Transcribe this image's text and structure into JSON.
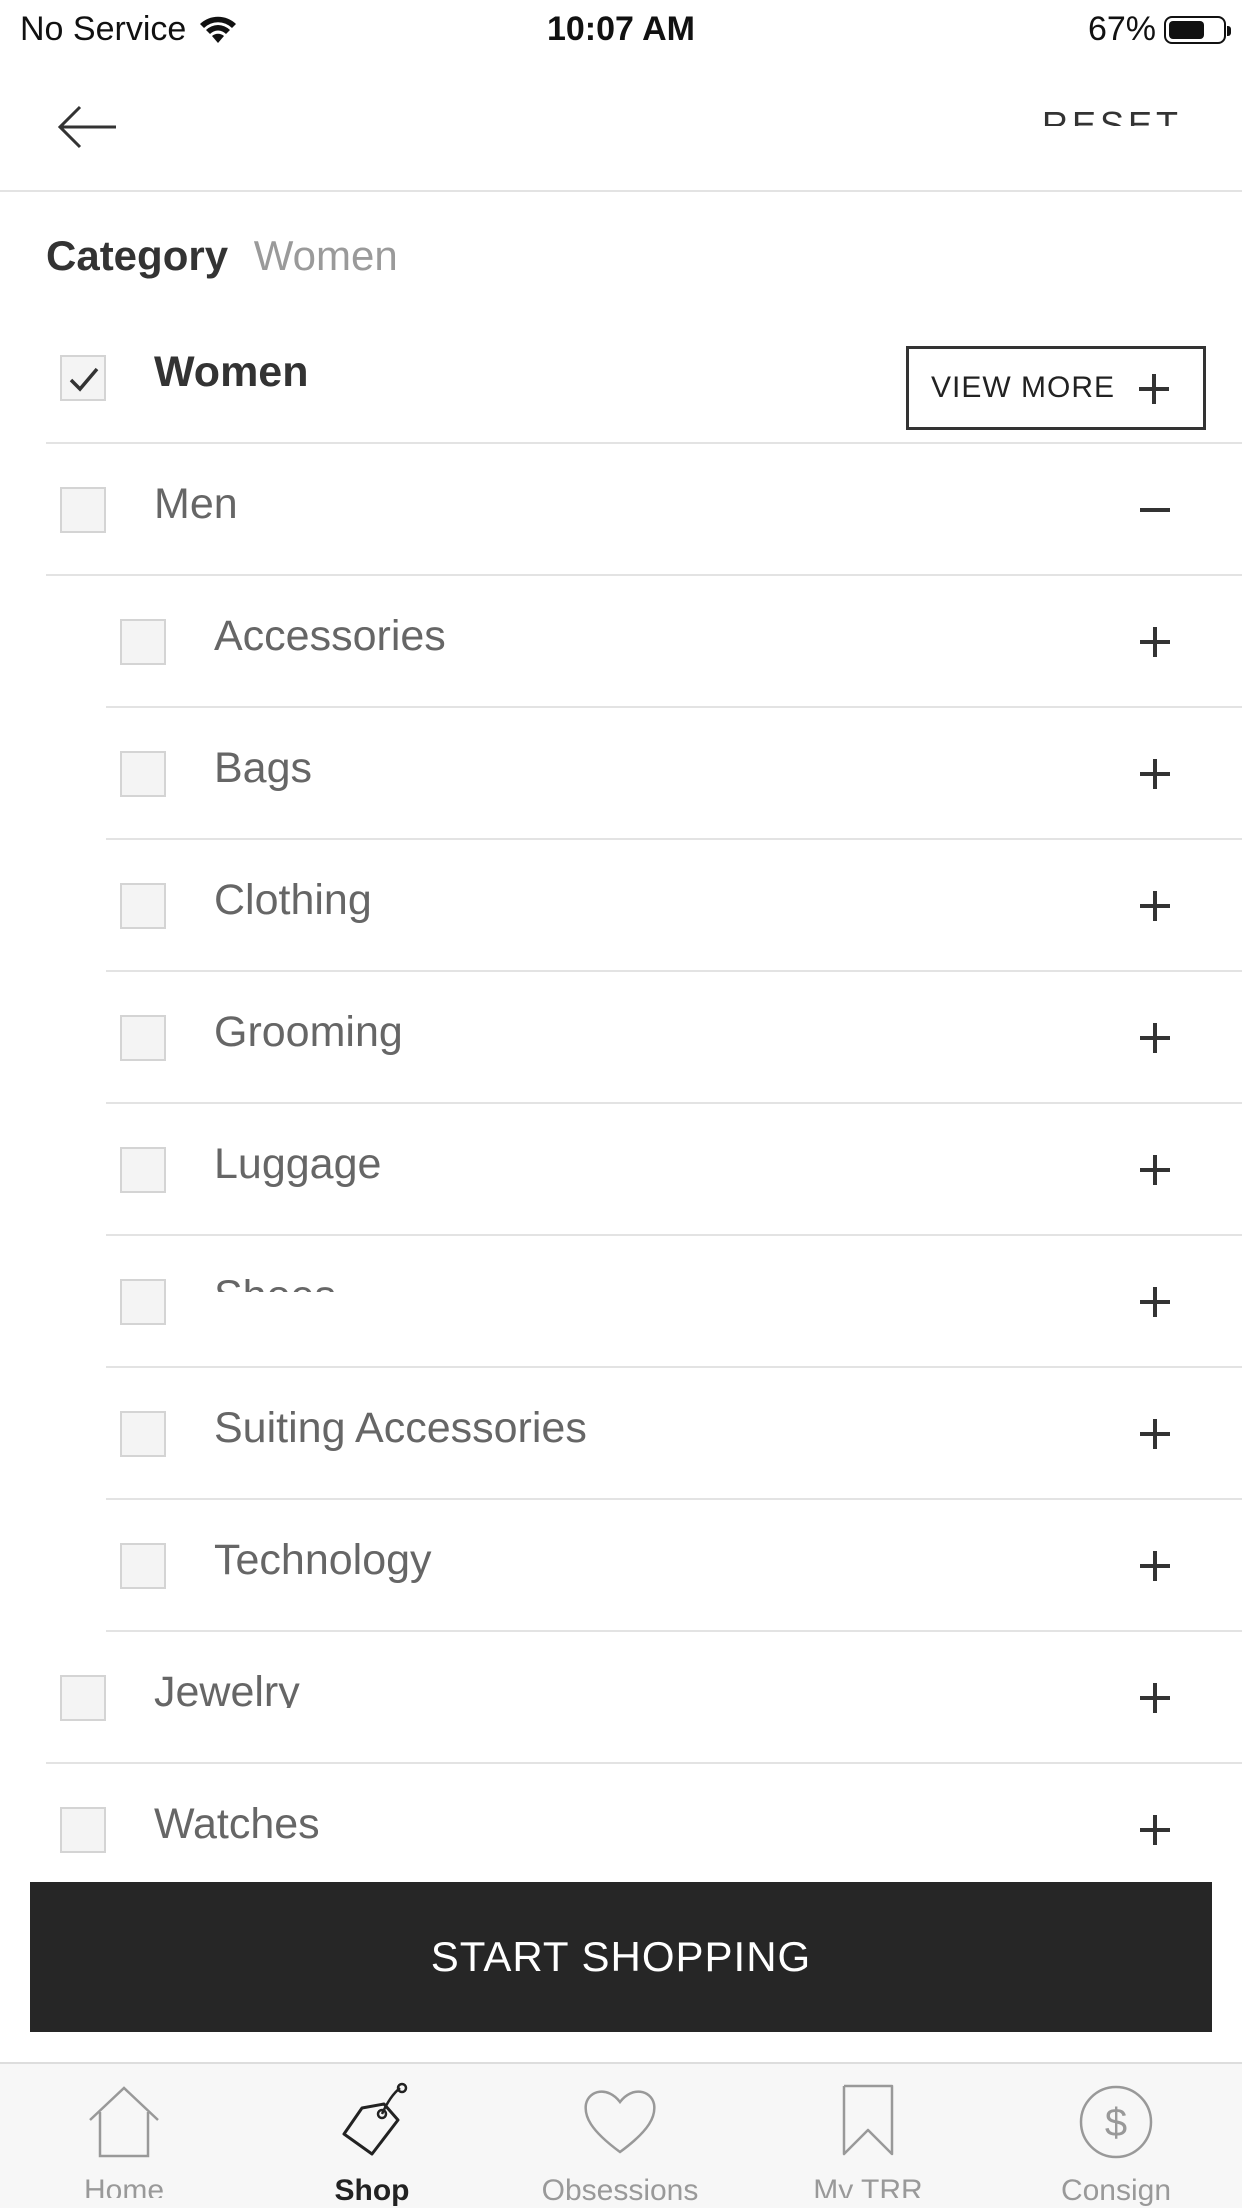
{
  "status_bar": {
    "carrier": "No Service",
    "time": "10:07 AM",
    "battery": "67%",
    "battery_level": 0.67
  },
  "nav": {
    "reset_label": "RESET"
  },
  "category": {
    "label": "Category",
    "value": "Women"
  },
  "view_more_label": "VIEW MORE",
  "top_items": [
    {
      "label": "Women",
      "checked": true
    },
    {
      "label": "Men",
      "checked": false,
      "expanded": true
    },
    {
      "label": "Jewelry",
      "checked": false
    },
    {
      "label": "Watches",
      "checked": false
    }
  ],
  "men_subitems": [
    {
      "label": "Accessories"
    },
    {
      "label": "Bags"
    },
    {
      "label": "Clothing"
    },
    {
      "label": "Grooming"
    },
    {
      "label": "Luggage"
    },
    {
      "label": "Shoes"
    },
    {
      "label": "Suiting Accessories"
    },
    {
      "label": "Technology"
    }
  ],
  "start_shopping_label": "START SHOPPING",
  "tabs": [
    {
      "label": "Home",
      "icon": "home-icon"
    },
    {
      "label": "Shop",
      "icon": "shopping-tag-icon",
      "active": true
    },
    {
      "label": "Obsessions",
      "icon": "heart-icon"
    },
    {
      "label": "My TRR",
      "icon": "bookmark-icon"
    },
    {
      "label": "Consign",
      "icon": "dollar-circle-icon"
    }
  ]
}
